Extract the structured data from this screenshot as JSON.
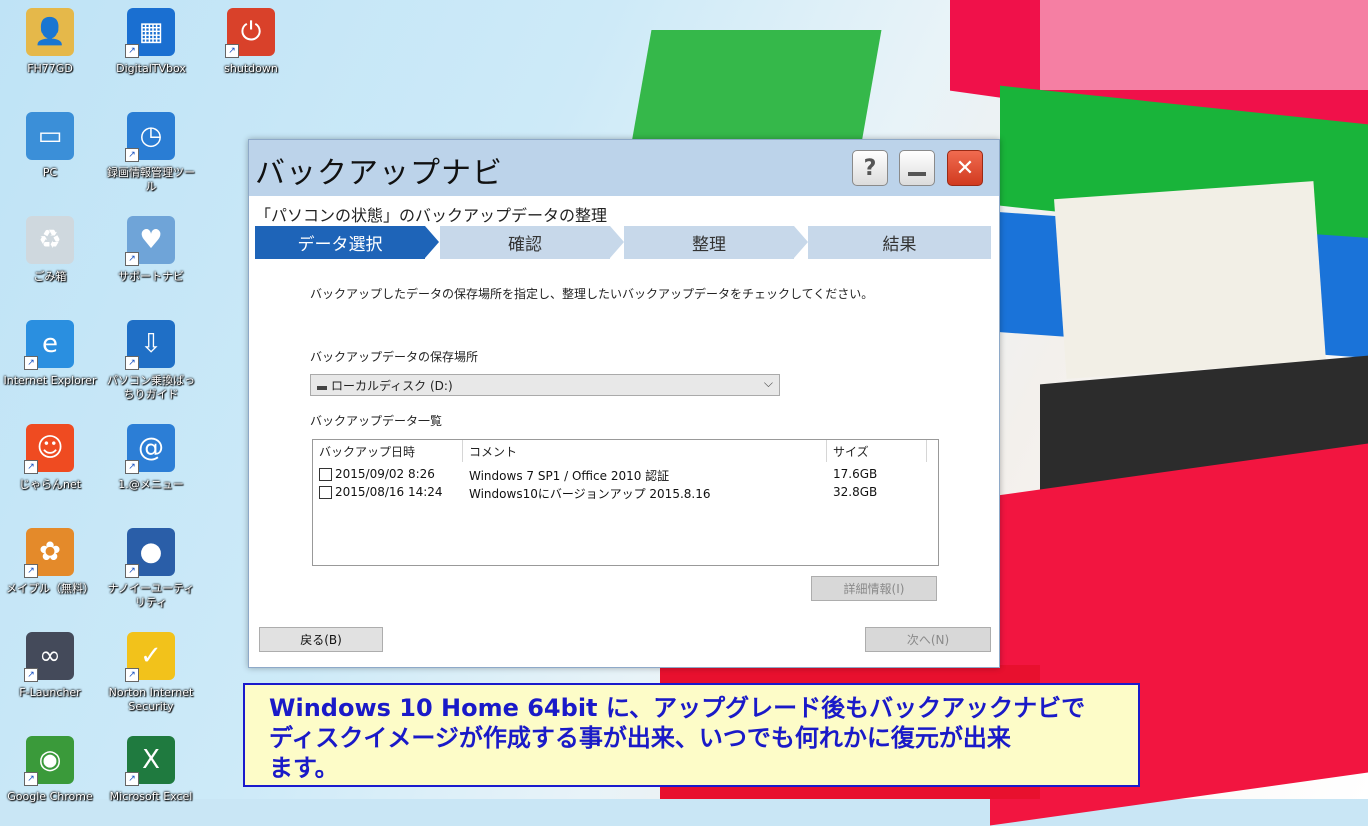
{
  "desktop_icons": [
    {
      "label": "FH77GD",
      "icon": "user-folder-icon",
      "color": "#e5b84a"
    },
    {
      "label": "DigitalTVbox",
      "icon": "tv-icon",
      "color": "#1a6fd1"
    },
    {
      "label": "shutdown",
      "icon": "power-icon",
      "color": "#d9412a"
    },
    {
      "label": "PC",
      "icon": "computer-icon",
      "color": "#3b8fd8"
    },
    {
      "label": "録画情報管理ツール",
      "icon": "video-clock-icon",
      "color": "#2a7dd4"
    },
    {
      "label": "ごみ箱",
      "icon": "recycle-bin-icon",
      "color": "#cfd8de"
    },
    {
      "label": "サポートナビ",
      "icon": "support-heart-icon",
      "color": "#6fa4d8"
    },
    {
      "label": "Internet Explorer",
      "icon": "ie-icon",
      "color": "#2a8fe0"
    },
    {
      "label": "パソコン乗換ばっちりガイド",
      "icon": "transfer-guide-icon",
      "color": "#1f6fc6"
    },
    {
      "label": "じゃらんnet",
      "icon": "jalan-icon",
      "color": "#ef4b21"
    },
    {
      "label": "1.@メニュー",
      "icon": "at-menu-icon",
      "color": "#2c7ed6"
    },
    {
      "label": "メイプル（無料）",
      "icon": "maple-game-icon",
      "color": "#e48a2a"
    },
    {
      "label": "ナノイーユーティリティ",
      "icon": "nanoe-icon",
      "color": "#2a5ea8"
    },
    {
      "label": "F-Launcher",
      "icon": "launcher-icon",
      "color": "#444a5a"
    },
    {
      "label": "Norton Internet Security",
      "icon": "norton-check-icon",
      "color": "#f2c21b"
    },
    {
      "label": "Google Chrome",
      "icon": "chrome-icon",
      "color": "#3a9a3a"
    },
    {
      "label": "Microsoft Excel",
      "icon": "excel-icon",
      "color": "#1f7a3f"
    }
  ],
  "window": {
    "title": "バックアップナビ",
    "help_label": "?",
    "subtitle": "「パソコンの状態」のバックアップデータの整理",
    "steps": [
      "データ選択",
      "確認",
      "整理",
      "結果"
    ],
    "instruction": "バックアップしたデータの保存場所を指定し、整理したいバックアップデータをチェックしてください。",
    "location_label": "バックアップデータの保存場所",
    "location_value": "ローカルディスク (D:)",
    "list_label": "バックアップデータ一覧",
    "columns": [
      "バックアップ日時",
      "コメント",
      "サイズ"
    ],
    "rows": [
      {
        "date": "2015/09/02 8:26",
        "comment": "Windows 7 SP1 / Office 2010 認証",
        "size": "17.6GB"
      },
      {
        "date": "2015/08/16 14:24",
        "comment": "Windows10にバージョンアップ 2015.8.16",
        "size": "32.8GB"
      }
    ],
    "detail_button": "詳細情報(I)",
    "back_button": "戻る(B)",
    "next_button": "次へ(N)"
  },
  "caption": {
    "lines": [
      "Windows 10 Home 64bit に、アップグレード後もバックアックナビで",
      "ディスクイメージが作成する事が出来、いつでも何れかに復元が出来",
      "ます。"
    ]
  }
}
